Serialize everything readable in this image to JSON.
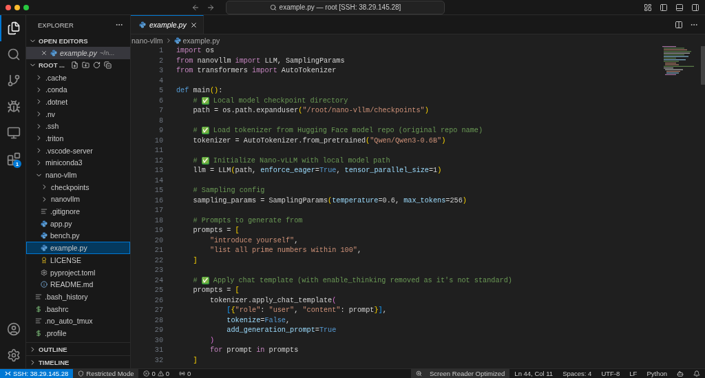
{
  "title_bar": {
    "search_text": "example.py — root [SSH: 38.29.145.28]"
  },
  "activity_bar": {
    "items": [
      {
        "kind": "files",
        "selected": true
      },
      {
        "kind": "search",
        "selected": false
      },
      {
        "kind": "source-control",
        "selected": false
      },
      {
        "kind": "run-debug",
        "selected": false
      },
      {
        "kind": "remote",
        "selected": false
      },
      {
        "kind": "extensions",
        "selected": false,
        "badge": "1"
      }
    ],
    "bottom_items": [
      {
        "kind": "account",
        "selected": false
      },
      {
        "kind": "settings",
        "selected": false
      }
    ]
  },
  "explorer": {
    "title": "EXPLORER",
    "open_editors": {
      "title": "OPEN EDITORS",
      "expanded": true,
      "items": [
        {
          "label": "example.py",
          "description": "~/n...",
          "selected": true
        }
      ]
    },
    "root": {
      "title": "ROOT ...",
      "expanded": true
    },
    "tree": [
      {
        "label": ".cache",
        "kind": "folder",
        "expanded": false,
        "selected": false
      },
      {
        "label": ".conda",
        "kind": "folder",
        "expanded": false,
        "selected": false
      },
      {
        "label": ".dotnet",
        "kind": "folder",
        "expanded": false,
        "selected": false
      },
      {
        "label": ".nv",
        "kind": "folder",
        "expanded": false,
        "selected": false
      },
      {
        "label": ".ssh",
        "kind": "folder",
        "expanded": false,
        "selected": false
      },
      {
        "label": ".triton",
        "kind": "folder",
        "expanded": false,
        "selected": false
      },
      {
        "label": ".vscode-server",
        "kind": "folder",
        "expanded": false,
        "selected": false
      },
      {
        "label": "miniconda3",
        "kind": "folder",
        "expanded": false,
        "selected": false
      },
      {
        "label": "nano-vllm",
        "kind": "folder",
        "expanded": true,
        "selected": false,
        "children": [
          {
            "label": "checkpoints",
            "kind": "folder",
            "expanded": false,
            "selected": false
          },
          {
            "label": "nanovllm",
            "kind": "folder",
            "expanded": false,
            "selected": false
          },
          {
            "label": ".gitignore",
            "kind": "text",
            "selected": false
          },
          {
            "label": "app.py",
            "kind": "python",
            "selected": false
          },
          {
            "label": "bench.py",
            "kind": "python",
            "selected": false
          },
          {
            "label": "example.py",
            "kind": "python",
            "selected": true
          },
          {
            "label": "LICENSE",
            "kind": "license",
            "selected": false
          },
          {
            "label": "pyproject.toml",
            "kind": "gear",
            "selected": false
          },
          {
            "label": "README.md",
            "kind": "info",
            "selected": false
          }
        ]
      },
      {
        "label": ".bash_history",
        "kind": "text",
        "selected": false
      },
      {
        "label": ".bashrc",
        "kind": "shell",
        "selected": false
      },
      {
        "label": ".no_auto_tmux",
        "kind": "text",
        "selected": false
      },
      {
        "label": ".profile",
        "kind": "shell",
        "selected": false
      }
    ],
    "sections": [
      {
        "title": "OUTLINE",
        "expanded": false
      },
      {
        "title": "TIMELINE",
        "expanded": false
      }
    ]
  },
  "tabs": [
    {
      "label": "example.py",
      "selected": true
    }
  ],
  "breadcrumbs": [
    "nano-vllm",
    "example.py"
  ],
  "code": [
    {
      "number": "1",
      "tokens": [
        {
          "kind": "keyword",
          "text": "import"
        },
        {
          "kind": "plain",
          "text": " os"
        }
      ]
    },
    {
      "number": "2",
      "tokens": [
        {
          "kind": "keyword",
          "text": "from"
        },
        {
          "kind": "plain",
          "text": " nanovllm "
        },
        {
          "kind": "keyword",
          "text": "import"
        },
        {
          "kind": "plain",
          "text": " LLM, SamplingParams"
        }
      ]
    },
    {
      "number": "3",
      "tokens": [
        {
          "kind": "keyword",
          "text": "from"
        },
        {
          "kind": "plain",
          "text": " transformers "
        },
        {
          "kind": "keyword",
          "text": "import"
        },
        {
          "kind": "plain",
          "text": " AutoTokenizer"
        }
      ]
    },
    {
      "number": "4"
    },
    {
      "number": "5",
      "tokens": [
        {
          "kind": "storage",
          "text": "def"
        },
        {
          "kind": "plain",
          "text": " main"
        },
        {
          "kind": "bracket1",
          "text": "()"
        },
        {
          "kind": "plain",
          "text": ":"
        }
      ]
    },
    {
      "number": "6",
      "tokens": [
        {
          "kind": "comment",
          "text": "    # "
        },
        {
          "kind": "emoji",
          "text": "✅"
        },
        {
          "kind": "comment",
          "text": " Local model checkpoint directory"
        }
      ]
    },
    {
      "number": "7",
      "tokens": [
        {
          "kind": "plain",
          "text": "    path = os.path.expanduser"
        },
        {
          "kind": "bracket1",
          "text": "("
        },
        {
          "kind": "string",
          "text": "\"/root/nano-vllm/checkpoints\""
        },
        {
          "kind": "bracket1",
          "text": ")"
        }
      ]
    },
    {
      "number": "8"
    },
    {
      "number": "9",
      "tokens": [
        {
          "kind": "comment",
          "text": "    # "
        },
        {
          "kind": "emoji",
          "text": "✅"
        },
        {
          "kind": "comment",
          "text": " Load tokenizer from Hugging Face model repo (original repo name)"
        }
      ]
    },
    {
      "number": "10",
      "tokens": [
        {
          "kind": "plain",
          "text": "    tokenizer = AutoTokenizer.from_pretrained"
        },
        {
          "kind": "bracket1",
          "text": "("
        },
        {
          "kind": "string",
          "text": "\"Qwen/Qwen3-0.6B\""
        },
        {
          "kind": "bracket1",
          "text": ")"
        }
      ]
    },
    {
      "number": "11"
    },
    {
      "number": "12",
      "tokens": [
        {
          "kind": "comment",
          "text": "    # "
        },
        {
          "kind": "emoji",
          "text": "✅"
        },
        {
          "kind": "comment",
          "text": " Initialize Nano-vLLM with local model path"
        }
      ]
    },
    {
      "number": "13",
      "tokens": [
        {
          "kind": "plain",
          "text": "    llm = LLM"
        },
        {
          "kind": "bracket1",
          "text": "("
        },
        {
          "kind": "plain",
          "text": "path, "
        },
        {
          "kind": "param",
          "text": "enforce_eager"
        },
        {
          "kind": "plain",
          "text": "="
        },
        {
          "kind": "constant",
          "text": "True"
        },
        {
          "kind": "plain",
          "text": ", "
        },
        {
          "kind": "param",
          "text": "tensor_parallel_size"
        },
        {
          "kind": "plain",
          "text": "=1"
        },
        {
          "kind": "bracket1",
          "text": ")"
        }
      ]
    },
    {
      "number": "14"
    },
    {
      "number": "15",
      "tokens": [
        {
          "kind": "comment",
          "text": "    # Sampling config"
        }
      ]
    },
    {
      "number": "16",
      "tokens": [
        {
          "kind": "plain",
          "text": "    sampling_params = SamplingParams"
        },
        {
          "kind": "bracket1",
          "text": "("
        },
        {
          "kind": "param",
          "text": "temperature"
        },
        {
          "kind": "plain",
          "text": "=0.6, "
        },
        {
          "kind": "param",
          "text": "max_tokens"
        },
        {
          "kind": "plain",
          "text": "=256"
        },
        {
          "kind": "bracket1",
          "text": ")"
        }
      ]
    },
    {
      "number": "17"
    },
    {
      "number": "18",
      "tokens": [
        {
          "kind": "comment",
          "text": "    # Prompts to generate from"
        }
      ]
    },
    {
      "number": "19",
      "tokens": [
        {
          "kind": "plain",
          "text": "    prompts = "
        },
        {
          "kind": "bracket1",
          "text": "["
        }
      ]
    },
    {
      "number": "20",
      "tokens": [
        {
          "kind": "string",
          "text": "        \"introduce yourself\""
        },
        {
          "kind": "plain",
          "text": ","
        }
      ]
    },
    {
      "number": "21",
      "tokens": [
        {
          "kind": "string",
          "text": "        \"list all prime numbers within 100\""
        },
        {
          "kind": "plain",
          "text": ","
        }
      ]
    },
    {
      "number": "22",
      "tokens": [
        {
          "kind": "bracket1",
          "text": "    ]"
        }
      ]
    },
    {
      "number": "23"
    },
    {
      "number": "24",
      "tokens": [
        {
          "kind": "comment",
          "text": "    # "
        },
        {
          "kind": "emoji",
          "text": "✅"
        },
        {
          "kind": "comment",
          "text": " Apply chat template (with enable_thinking removed as it's not standard)"
        }
      ]
    },
    {
      "number": "25",
      "tokens": [
        {
          "kind": "plain",
          "text": "    prompts = "
        },
        {
          "kind": "bracket1",
          "text": "["
        }
      ]
    },
    {
      "number": "26",
      "tokens": [
        {
          "kind": "plain",
          "text": "        tokenizer.apply_chat_template"
        },
        {
          "kind": "bracket2",
          "text": "("
        }
      ]
    },
    {
      "number": "27",
      "tokens": [
        {
          "kind": "bracket3",
          "text": "            ["
        },
        {
          "kind": "bracket1",
          "text": "{"
        },
        {
          "kind": "string",
          "text": "\"role\""
        },
        {
          "kind": "plain",
          "text": ": "
        },
        {
          "kind": "string",
          "text": "\"user\""
        },
        {
          "kind": "plain",
          "text": ", "
        },
        {
          "kind": "string",
          "text": "\"content\""
        },
        {
          "kind": "plain",
          "text": ": prompt"
        },
        {
          "kind": "bracket1",
          "text": "}"
        },
        {
          "kind": "bracket3",
          "text": "]"
        },
        {
          "kind": "plain",
          "text": ","
        }
      ]
    },
    {
      "number": "28",
      "tokens": [
        {
          "kind": "param",
          "text": "            tokenize"
        },
        {
          "kind": "plain",
          "text": "="
        },
        {
          "kind": "constant",
          "text": "False"
        },
        {
          "kind": "plain",
          "text": ","
        }
      ]
    },
    {
      "number": "29",
      "tokens": [
        {
          "kind": "param",
          "text": "            add_generation_prompt"
        },
        {
          "kind": "plain",
          "text": "="
        },
        {
          "kind": "constant",
          "text": "True"
        }
      ]
    },
    {
      "number": "30",
      "tokens": [
        {
          "kind": "bracket2",
          "text": "        )"
        }
      ]
    },
    {
      "number": "31",
      "tokens": [
        {
          "kind": "keyword",
          "text": "        for"
        },
        {
          "kind": "plain",
          "text": " prompt "
        },
        {
          "kind": "keyword",
          "text": "in"
        },
        {
          "kind": "plain",
          "text": " prompts"
        }
      ]
    },
    {
      "number": "32",
      "tokens": [
        {
          "kind": "bracket1",
          "text": "    ]"
        }
      ]
    }
  ],
  "status_bar": {
    "left": [
      {
        "kind": "remote",
        "text": "SSH: 38.29.145.28"
      },
      {
        "kind": "restricted",
        "text": "Restricted Mode"
      },
      {
        "kind": "problems",
        "errors": "0",
        "warnings": "0"
      },
      {
        "kind": "ports",
        "text": "0"
      }
    ],
    "right": [
      {
        "kind": "screen-reader",
        "text": "Screen Reader Optimized"
      },
      {
        "kind": "text",
        "text": "Ln 44, Col 11"
      },
      {
        "kind": "text",
        "text": "Spaces: 4"
      },
      {
        "kind": "text",
        "text": "UTF-8"
      },
      {
        "kind": "text",
        "text": "LF"
      },
      {
        "kind": "text",
        "text": "Python"
      },
      {
        "kind": "copilot"
      },
      {
        "kind": "bell"
      }
    ]
  }
}
